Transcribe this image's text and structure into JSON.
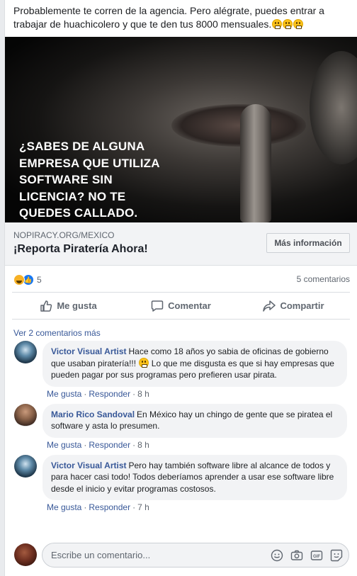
{
  "post": {
    "text": "Probablemente te corren de la agencia. Pero alégrate, puedes entrar a trabajar de huachicolero y que te den tus 8000 mensuales."
  },
  "ad": {
    "headline": "¿SABES DE ALGUNA EMPRESA QUE UTILIZA SOFTWARE SIN LICENCIA? NO TE QUEDES CALLADO.",
    "domain": "NOPIRACY.ORG/MEXICO",
    "title": "¡Reporta Piratería Ahora!",
    "cta_label": "Más información"
  },
  "reactions": {
    "count": "5",
    "comments_label": "5 comentarios"
  },
  "actions": {
    "like": "Me gusta",
    "comment": "Comentar",
    "share": "Compartir"
  },
  "comments": {
    "view_more": "Ver 2 comentarios más",
    "items": [
      {
        "author": "Victor Visual Artist",
        "text_before": "Hace como 18 años yo sabia de oficinas de gobierno que usaban piratería!!!",
        "text_after": "Lo que me disgusta es que si hay empresas que pueden pagar por sus programas pero prefieren usar pirata.",
        "like": "Me gusta",
        "reply": "Responder",
        "time": "8 h"
      },
      {
        "author": "Mario Rico Sandoval",
        "text": "En México hay un chingo de gente que se piratea el software y asta lo presumen.",
        "like": "Me gusta",
        "reply": "Responder",
        "time": "8 h"
      },
      {
        "author": "Victor Visual Artist",
        "text": "Pero hay también software libre al alcance de todos y para hacer casi todo! Todos deberíamos aprender a usar ese software libre desde el inicio y evitar programas costosos.",
        "like": "Me gusta",
        "reply": "Responder",
        "time": "7 h"
      }
    ]
  },
  "composer": {
    "placeholder": "Escribe un comentario..."
  },
  "colors": {
    "link": "#385898",
    "like_blue": "#1877f2",
    "meta_gray": "#606770"
  }
}
